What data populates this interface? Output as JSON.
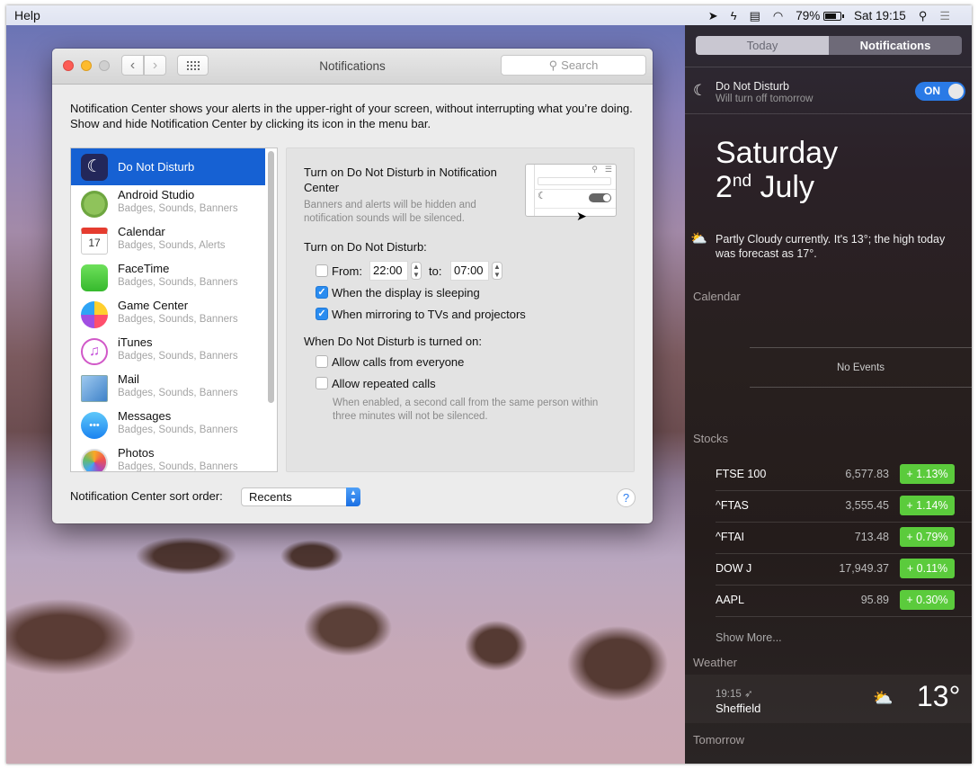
{
  "menubar": {
    "app_menu": "Help",
    "battery_percent": "79%",
    "clock": "Sat 19:15",
    "icons": [
      "location-icon",
      "flash-icon",
      "printer-icon",
      "wifi-icon",
      "battery-icon",
      "spotlight-icon",
      "notification-center-icon"
    ]
  },
  "window": {
    "title": "Notifications",
    "search_placeholder": "Search",
    "intro": "Notification Center shows your alerts in the upper-right of your screen, without interrupting what you’re doing. Show and hide Notification Center by clicking its icon in the menu bar.",
    "apps": [
      {
        "name": "Do Not Disturb",
        "detail": "",
        "selected": true
      },
      {
        "name": "Android Studio",
        "detail": "Badges, Sounds, Banners"
      },
      {
        "name": "Calendar",
        "detail": "Badges, Sounds, Alerts"
      },
      {
        "name": "FaceTime",
        "detail": "Badges, Sounds, Banners"
      },
      {
        "name": "Game Center",
        "detail": "Badges, Sounds, Banners"
      },
      {
        "name": "iTunes",
        "detail": "Badges, Sounds, Banners"
      },
      {
        "name": "Mail",
        "detail": "Badges, Sounds, Banners"
      },
      {
        "name": "Messages",
        "detail": "Badges, Sounds, Banners"
      },
      {
        "name": "Photos",
        "detail": "Badges, Sounds, Banners"
      }
    ],
    "calendar_icon_day": "17",
    "calendar_icon_month": "JUL",
    "dnd": {
      "nc_title": "Turn on Do Not Disturb in Notification Center",
      "nc_desc": "Banners and alerts will be hidden and notification sounds will be silenced.",
      "schedule_heading": "Turn on Do Not Disturb:",
      "from_label": "From:",
      "from_value": "22:00",
      "to_label": "to:",
      "to_value": "07:00",
      "from_checked": false,
      "sleeping_label": "When the display is sleeping",
      "sleeping_checked": true,
      "mirroring_label": "When mirroring to TVs and projectors",
      "mirroring_checked": true,
      "on_heading": "When Do Not Disturb is turned on:",
      "calls_label": "Allow calls from everyone",
      "calls_checked": false,
      "repeated_label": "Allow repeated calls",
      "repeated_checked": false,
      "repeated_desc": "When enabled, a second call from the same person within three minutes will not be silenced."
    },
    "sort_label": "Notification Center sort order:",
    "sort_value": "Recents",
    "help": "?"
  },
  "nc": {
    "tabs": [
      {
        "label": "Today"
      },
      {
        "label": "Notifications",
        "active": true
      }
    ],
    "dnd_title": "Do Not Disturb",
    "dnd_sub": "Will turn off tomorrow",
    "dnd_toggle": "ON",
    "date_day": "Saturday",
    "date_num": "2",
    "date_suffix": "nd",
    "date_month": "July",
    "weather_summary": "Partly Cloudy currently. It's 13°; the high today was forecast as 17°.",
    "calendar_heading": "Calendar",
    "no_events": "No Events",
    "stocks_heading": "Stocks",
    "stocks": [
      {
        "symbol": "FTSE 100",
        "price": "6,577.83",
        "change": "+  1.13%"
      },
      {
        "symbol": "^FTAS",
        "price": "3,555.45",
        "change": "+  1.14%"
      },
      {
        "symbol": "^FTAI",
        "price": "713.48",
        "change": "+ 0.79%"
      },
      {
        "symbol": "DOW J",
        "price": "17,949.37",
        "change": "+  0.11%"
      },
      {
        "symbol": "AAPL",
        "price": "95.89",
        "change": "+ 0.30%"
      }
    ],
    "show_more": "Show More...",
    "weather_heading": "Weather",
    "weather_time": "19:15 ➶",
    "weather_city": "Sheffield",
    "weather_temp": "13°",
    "tomorrow_heading": "Tomorrow",
    "colors": {
      "stock_up": "#5bcb3c",
      "toggle_on": "#2a7ae6",
      "selection": "#1661d3"
    }
  }
}
